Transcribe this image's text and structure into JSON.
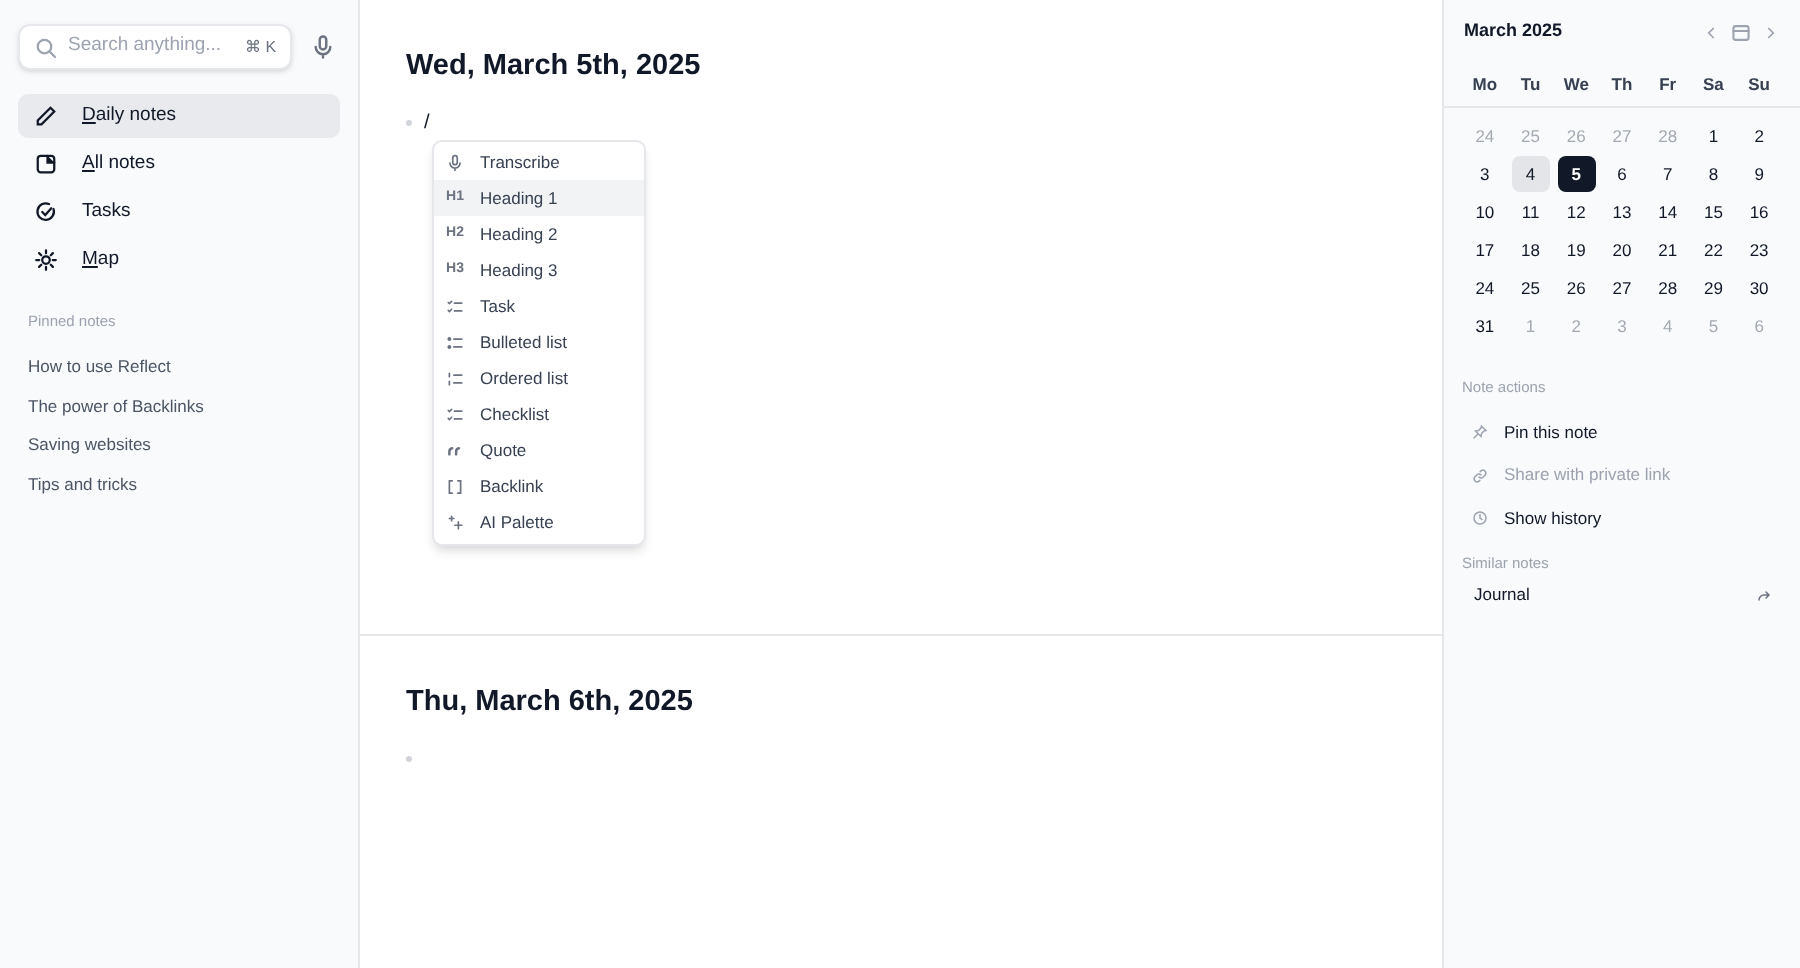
{
  "sidebar": {
    "search": {
      "placeholder": "Search anything...",
      "shortcut": "⌘ K"
    },
    "nav": [
      {
        "label": "Daily notes",
        "selected": true,
        "hotkey_underlined": true
      },
      {
        "label": "All notes",
        "selected": false,
        "hotkey_underlined": true
      },
      {
        "label": "Tasks",
        "selected": false,
        "hotkey_underlined": false
      },
      {
        "label": "Map",
        "selected": false,
        "hotkey_underlined": true
      }
    ],
    "pinned_heading": "Pinned notes",
    "pinned": [
      "How to use Reflect",
      "The power of Backlinks",
      "Saving websites",
      "Tips and tricks"
    ]
  },
  "days": [
    {
      "title": "Wed, March 5th, 2025",
      "typed": "/"
    },
    {
      "title": "Thu, March 6th, 2025"
    }
  ],
  "slash_menu": [
    {
      "label": "Transcribe",
      "kind": "mic",
      "selected": false
    },
    {
      "label": "Heading 1",
      "kind": "heading",
      "glyph": "H1",
      "selected": true
    },
    {
      "label": "Heading 2",
      "kind": "heading",
      "glyph": "H2",
      "selected": false
    },
    {
      "label": "Heading 3",
      "kind": "heading",
      "glyph": "H3",
      "selected": false
    },
    {
      "label": "Task",
      "kind": "checklist",
      "selected": false
    },
    {
      "label": "Bulleted list",
      "kind": "bullets",
      "selected": false
    },
    {
      "label": "Ordered list",
      "kind": "ordered",
      "selected": false
    },
    {
      "label": "Checklist",
      "kind": "checklist",
      "selected": false
    },
    {
      "label": "Quote",
      "kind": "quote",
      "selected": false
    },
    {
      "label": "Backlink",
      "kind": "brackets",
      "selected": false
    },
    {
      "label": "AI Palette",
      "kind": "sparkle",
      "selected": false
    }
  ],
  "calendar": {
    "title": "March 2025",
    "weekdays": [
      "Mo",
      "Tu",
      "We",
      "Th",
      "Fr",
      "Sa",
      "Su"
    ],
    "days": [
      {
        "n": "24",
        "muted": true,
        "selected": false,
        "today": false
      },
      {
        "n": "25",
        "muted": true,
        "selected": false,
        "today": false
      },
      {
        "n": "26",
        "muted": true,
        "selected": false,
        "today": false
      },
      {
        "n": "27",
        "muted": true,
        "selected": false,
        "today": false
      },
      {
        "n": "28",
        "muted": true,
        "selected": false,
        "today": false
      },
      {
        "n": "1",
        "muted": false,
        "selected": false,
        "today": false
      },
      {
        "n": "2",
        "muted": false,
        "selected": false,
        "today": false
      },
      {
        "n": "3",
        "muted": false,
        "selected": false,
        "today": false
      },
      {
        "n": "4",
        "muted": false,
        "selected": false,
        "today": true
      },
      {
        "n": "5",
        "muted": false,
        "selected": true,
        "today": false
      },
      {
        "n": "6",
        "muted": false,
        "selected": false,
        "today": false
      },
      {
        "n": "7",
        "muted": false,
        "selected": false,
        "today": false
      },
      {
        "n": "8",
        "muted": false,
        "selected": false,
        "today": false
      },
      {
        "n": "9",
        "muted": false,
        "selected": false,
        "today": false
      },
      {
        "n": "10",
        "muted": false,
        "selected": false,
        "today": false
      },
      {
        "n": "11",
        "muted": false,
        "selected": false,
        "today": false
      },
      {
        "n": "12",
        "muted": false,
        "selected": false,
        "today": false
      },
      {
        "n": "13",
        "muted": false,
        "selected": false,
        "today": false
      },
      {
        "n": "14",
        "muted": false,
        "selected": false,
        "today": false
      },
      {
        "n": "15",
        "muted": false,
        "selected": false,
        "today": false
      },
      {
        "n": "16",
        "muted": false,
        "selected": false,
        "today": false
      },
      {
        "n": "17",
        "muted": false,
        "selected": false,
        "today": false
      },
      {
        "n": "18",
        "muted": false,
        "selected": false,
        "today": false
      },
      {
        "n": "19",
        "muted": false,
        "selected": false,
        "today": false
      },
      {
        "n": "20",
        "muted": false,
        "selected": false,
        "today": false
      },
      {
        "n": "21",
        "muted": false,
        "selected": false,
        "today": false
      },
      {
        "n": "22",
        "muted": false,
        "selected": false,
        "today": false
      },
      {
        "n": "23",
        "muted": false,
        "selected": false,
        "today": false
      },
      {
        "n": "24",
        "muted": false,
        "selected": false,
        "today": false
      },
      {
        "n": "25",
        "muted": false,
        "selected": false,
        "today": false
      },
      {
        "n": "26",
        "muted": false,
        "selected": false,
        "today": false
      },
      {
        "n": "27",
        "muted": false,
        "selected": false,
        "today": false
      },
      {
        "n": "28",
        "muted": false,
        "selected": false,
        "today": false
      },
      {
        "n": "29",
        "muted": false,
        "selected": false,
        "today": false
      },
      {
        "n": "30",
        "muted": false,
        "selected": false,
        "today": false
      },
      {
        "n": "31",
        "muted": false,
        "selected": false,
        "today": false
      },
      {
        "n": "1",
        "muted": true,
        "selected": false,
        "today": false
      },
      {
        "n": "2",
        "muted": true,
        "selected": false,
        "today": false
      },
      {
        "n": "3",
        "muted": true,
        "selected": false,
        "today": false
      },
      {
        "n": "4",
        "muted": true,
        "selected": false,
        "today": false
      },
      {
        "n": "5",
        "muted": true,
        "selected": false,
        "today": false
      },
      {
        "n": "6",
        "muted": true,
        "selected": false,
        "today": false
      }
    ]
  },
  "note_actions": {
    "heading": "Note actions",
    "items": [
      {
        "label": "Pin this note",
        "disabled": false
      },
      {
        "label": "Share with private link",
        "disabled": true
      },
      {
        "label": "Show history",
        "disabled": false
      }
    ]
  },
  "similar_notes": {
    "heading": "Similar notes",
    "items": [
      "Journal"
    ]
  }
}
